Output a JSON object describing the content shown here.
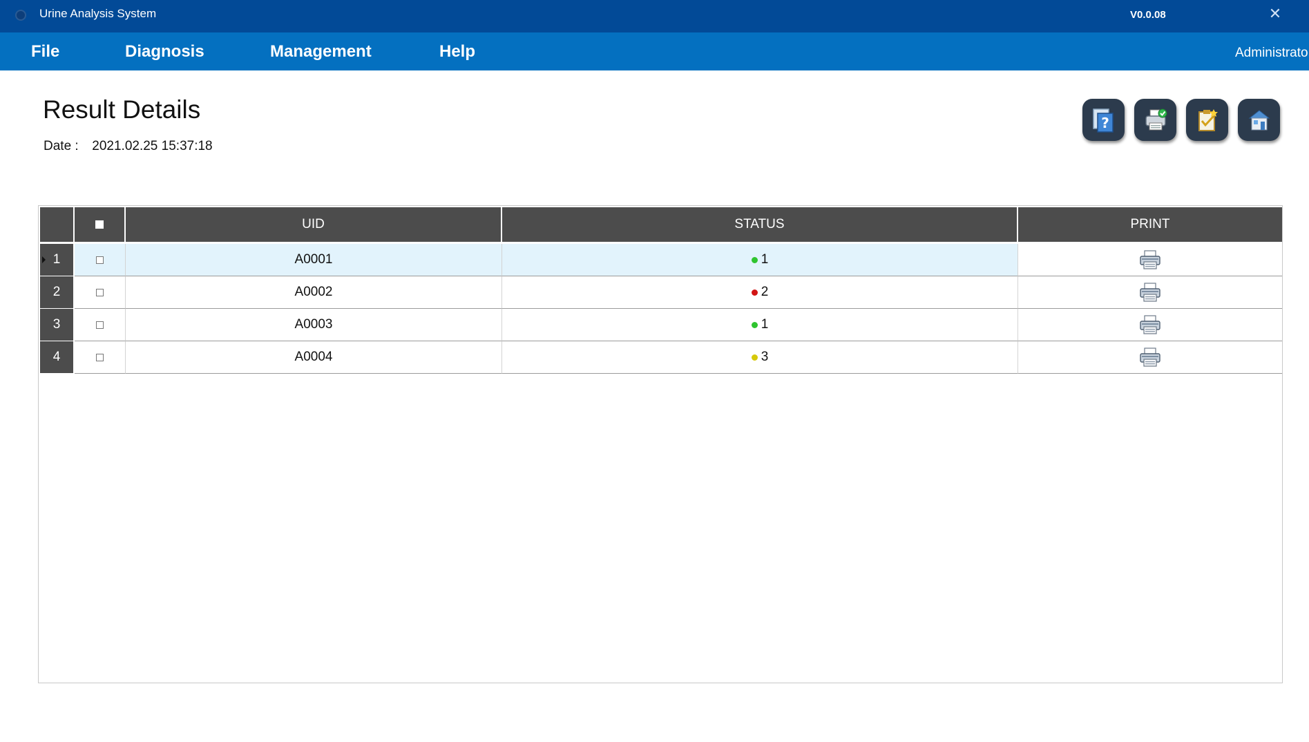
{
  "window": {
    "title": "Urine Analysis System",
    "version": "V0.0.08",
    "close_glyph": "✕"
  },
  "menu": {
    "items": [
      "File",
      "Diagnosis",
      "Management",
      "Help"
    ],
    "user": "Administrato"
  },
  "page": {
    "title": "Result Details",
    "date_label": "Date :",
    "date_value": "2021.02.25 15:37:18"
  },
  "toolbar": {
    "buttons": [
      "help-manual-icon",
      "print-check-icon",
      "report-edit-icon",
      "home-icon"
    ]
  },
  "table": {
    "columns": [
      "",
      "■",
      "UID",
      "STATUS",
      "PRINT"
    ],
    "rows": [
      {
        "num": "1",
        "uid": "A0001",
        "status": "1",
        "status_color": "#2fc42f",
        "selected": true
      },
      {
        "num": "2",
        "uid": "A0002",
        "status": "2",
        "status_color": "#d21515",
        "selected": false
      },
      {
        "num": "3",
        "uid": "A0003",
        "status": "1",
        "status_color": "#2fc42f",
        "selected": false
      },
      {
        "num": "4",
        "uid": "A0004",
        "status": "3",
        "status_color": "#d6c90a",
        "selected": false
      }
    ]
  }
}
